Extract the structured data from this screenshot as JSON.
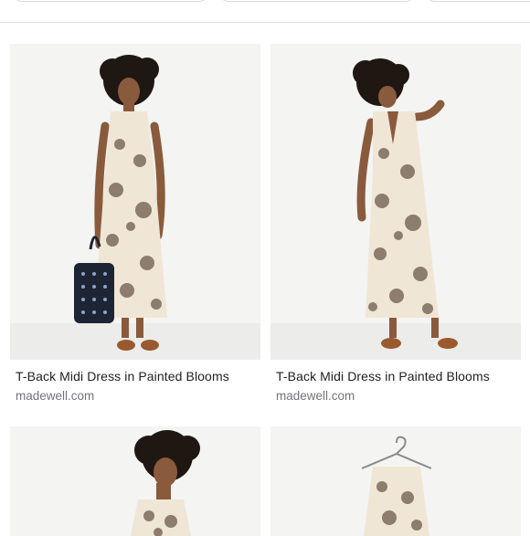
{
  "results": [
    {
      "title": "T-Back Midi Dress in Painted Blooms",
      "source": "madewell.com"
    },
    {
      "title": "T-Back Midi Dress in Painted Blooms",
      "source": "madewell.com"
    },
    {
      "title": "",
      "source": ""
    },
    {
      "title": "",
      "source": ""
    }
  ],
  "colors": {
    "dress": "#efe6d6",
    "print": "#6b5a4a",
    "hair": "#1f1712",
    "skin": "#8a5a3c",
    "sandal": "#9a5a2e",
    "bag": "#1d2433"
  }
}
